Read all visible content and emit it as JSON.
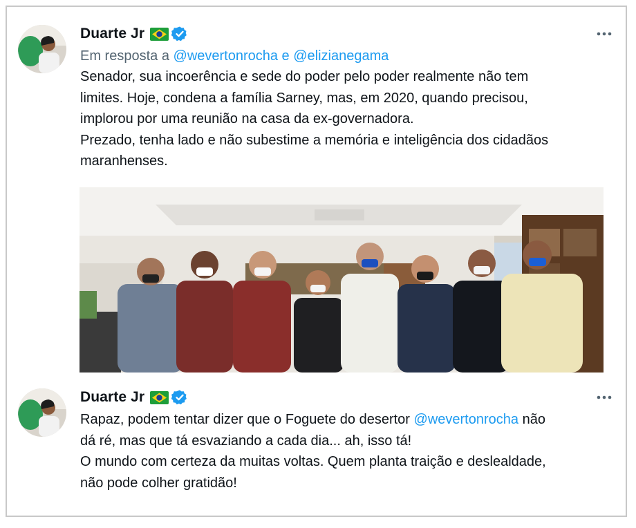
{
  "tweets": [
    {
      "author": "Duarte Jr",
      "reply_prefix": "Em resposta a ",
      "reply_handles": "@wevertonrocha e @elizianegama",
      "text": "Senador, sua incoerência e sede do poder pelo poder realmente não tem\nlimites. Hoje, condena a família Sarney, mas, em 2020, quando precisou,\nimplorou por uma reunião na casa da ex-governadora.\nPrezado, tenha lado e não subestime a memória e inteligência dos cidadãos\nmaranhenses."
    },
    {
      "author": "Duarte Jr",
      "text_part1": "Rapaz, podem tentar dizer que o Foguete do desertor ",
      "mention": "@wevertonrocha",
      "text_part2": " não\ndá ré, mas que tá esvaziando a cada dia... ah, isso tá!\nO mundo com certeza da muitas voltas. Quem planta traição e deslealdade,\nnão pode colher gratidão!"
    }
  ],
  "colors": {
    "link": "#1d9bf0",
    "verified": "#1d9bf0",
    "muted": "#536471"
  },
  "icons": [
    "brazil-flag-icon",
    "verified-badge-icon",
    "more-options-icon"
  ]
}
